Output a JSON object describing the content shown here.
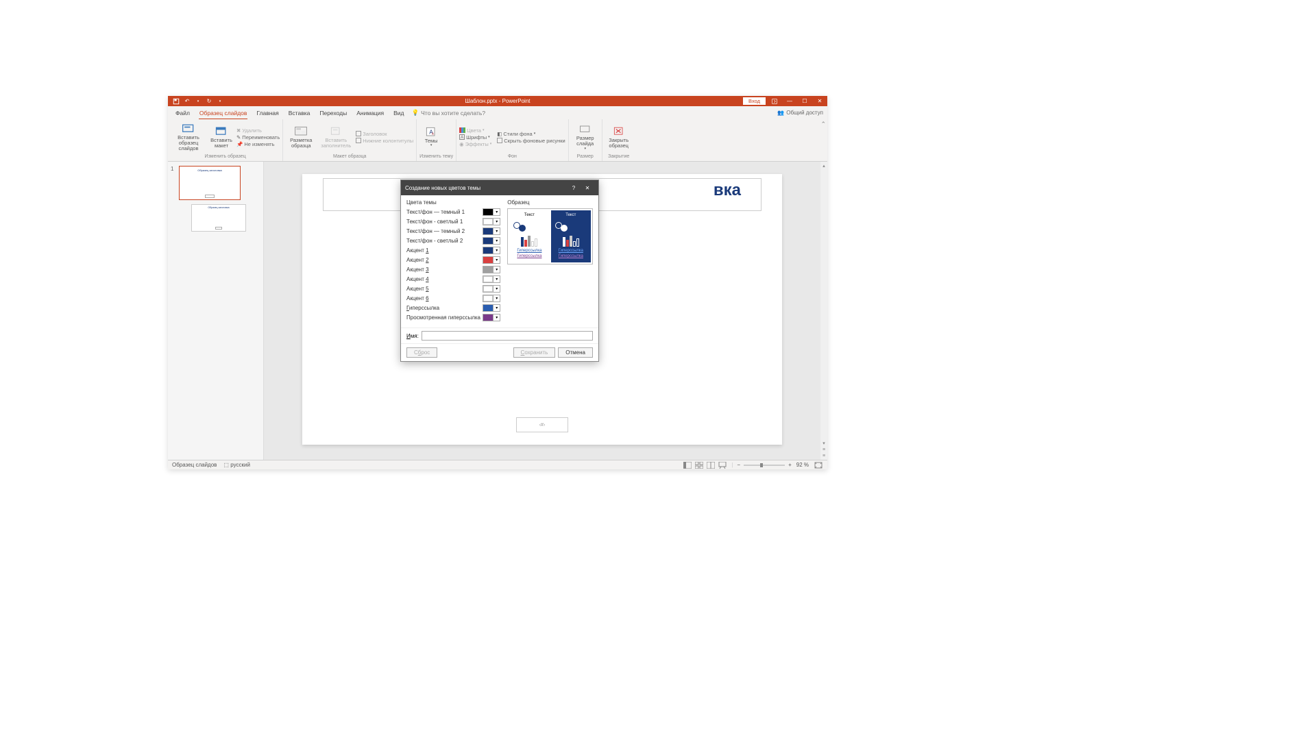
{
  "title_bar": {
    "document": "Шаблон.pptx  -  PowerPoint",
    "login": "Вход"
  },
  "menu": {
    "file": "Файл",
    "slide_master": "Образец слайдов",
    "home": "Главная",
    "insert": "Вставка",
    "transitions": "Переходы",
    "animations": "Анимация",
    "view": "Вид",
    "tell_me": "Что вы хотите сделать?",
    "share": "Общий доступ"
  },
  "ribbon": {
    "insert_master": "Вставить образец слайдов",
    "insert_layout": "Вставить макет",
    "delete": "Удалить",
    "rename": "Переименовать",
    "preserve": "Не изменять",
    "edit_master_group": "Изменить образец",
    "master_layout": "Разметка образца",
    "insert_placeholder": "Вставить заполнитель",
    "title_chk": "Заголовок",
    "footers_chk": "Нижние колонтитулы",
    "master_layout_group": "Макет образца",
    "themes": "Темы",
    "edit_theme_group": "Изменить тему",
    "colors": "Цвета",
    "fonts": "Шрифты",
    "effects": "Эффекты",
    "bg_styles": "Стили фона",
    "hide_bg": "Скрыть фоновые рисунки",
    "background_group": "Фон",
    "slide_size": "Размер слайда",
    "size_group": "Размер",
    "close_master": "Закрыть образец",
    "close_group": "Закрытие"
  },
  "slide": {
    "title_fragment": "вка",
    "footer_placeholder": "‹#›",
    "thumb_title": "Образец заголовка"
  },
  "status": {
    "mode": "Образец слайдов",
    "language": "русский",
    "zoom": "92 %"
  },
  "dialog": {
    "title": "Создание новых цветов темы",
    "section_colors": "Цвета темы",
    "section_sample": "Образец",
    "rows": [
      {
        "label": "Текст/фон — темный 1",
        "color": "#000000"
      },
      {
        "label": "Текст/фон - светлый 1",
        "color": "#ffffff"
      },
      {
        "label": "Текст/фон — темный 2",
        "color": "#1a3a7a"
      },
      {
        "label": "Текст/фон - светлый 2",
        "color": "#1a3a7a"
      },
      {
        "label_pre": "Акцент ",
        "label_u": "1",
        "color": "#1a3a7a"
      },
      {
        "label_pre": "Акцент ",
        "label_u": "2",
        "color": "#d94040"
      },
      {
        "label_pre": "Акцент ",
        "label_u": "3",
        "color": "#a0a0a0"
      },
      {
        "label_pre": "Акцент ",
        "label_u": "4",
        "color": "#ffffff"
      },
      {
        "label_pre": "Акцент ",
        "label_u": "5",
        "color": "#ffffff"
      },
      {
        "label_pre": "Акцент ",
        "label_u": "6",
        "color": "#ffffff"
      },
      {
        "label_pre_u": "Г",
        "label_post": "иперссылка",
        "color": "#2a5db0"
      },
      {
        "label": "Просмотренная гиперссылка",
        "color": "#7a3a8a"
      }
    ],
    "sample_text": "Текст",
    "hyperlink": "Гиперссылка",
    "visited_link": "Гиперссылка",
    "name_label_u": "И",
    "name_label_post": "мя:",
    "reset_u": "б",
    "reset_pre": "С",
    "reset_post": "рос",
    "save_u": "С",
    "save_post": "охранить",
    "cancel": "Отмена"
  }
}
